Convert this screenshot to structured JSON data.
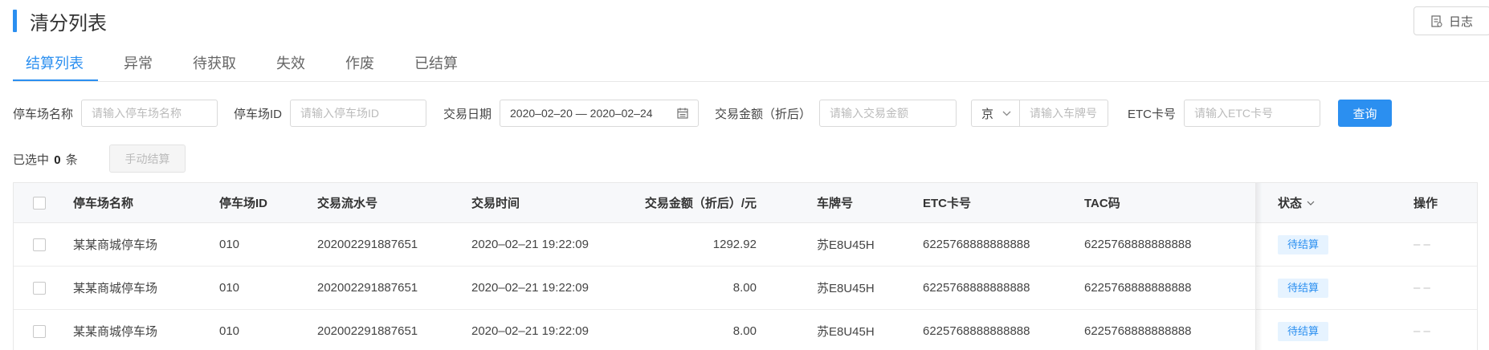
{
  "page": {
    "title": "清分列表",
    "log_label": "日志"
  },
  "tabs": [
    "结算列表",
    "异常",
    "待获取",
    "失效",
    "作废",
    "已结算"
  ],
  "filters": {
    "parking_name": {
      "label": "停车场名称",
      "placeholder": "请输入停车场名称"
    },
    "parking_id": {
      "label": "停车场ID",
      "placeholder": "请输入停车场ID"
    },
    "trade_date": {
      "label": "交易日期",
      "value": "2020–02–20 — 2020–02–24"
    },
    "amount": {
      "label": "交易金额（折后）",
      "placeholder": "请输入交易金额"
    },
    "plate": {
      "prefix": "京",
      "placeholder": "请输入车牌号"
    },
    "etc": {
      "label": "ETC卡号",
      "placeholder": "请输入ETC卡号"
    },
    "query_label": "查询"
  },
  "selection": {
    "prefix": "已选中",
    "count": "0",
    "suffix": "条",
    "manual_settle_label": "手动结算"
  },
  "table": {
    "columns": [
      "停车场名称",
      "停车场ID",
      "交易流水号",
      "交易时间",
      "交易金额（折后）/元",
      "车牌号",
      "ETC卡号",
      "TAC码",
      "状态",
      "操作"
    ],
    "rows": [
      {
        "name": "某某商城停车场",
        "id": "010",
        "serial": "202002291887651",
        "time": "2020–02–21 19:22:09",
        "amount": "1292.92",
        "plate": "苏E8U45H",
        "etc": "6225768888888888",
        "tac": "6225768888888888",
        "status": "待结算",
        "op": "– –"
      },
      {
        "name": "某某商城停车场",
        "id": "010",
        "serial": "202002291887651",
        "time": "2020–02–21 19:22:09",
        "amount": "8.00",
        "plate": "苏E8U45H",
        "etc": "6225768888888888",
        "tac": "6225768888888888",
        "status": "待结算",
        "op": "– –"
      },
      {
        "name": "某某商城停车场",
        "id": "010",
        "serial": "202002291887651",
        "time": "2020–02–21 19:22:09",
        "amount": "8.00",
        "plate": "苏E8U45H",
        "etc": "6225768888888888",
        "tac": "6225768888888888",
        "status": "待结算",
        "op": "– –"
      }
    ]
  }
}
